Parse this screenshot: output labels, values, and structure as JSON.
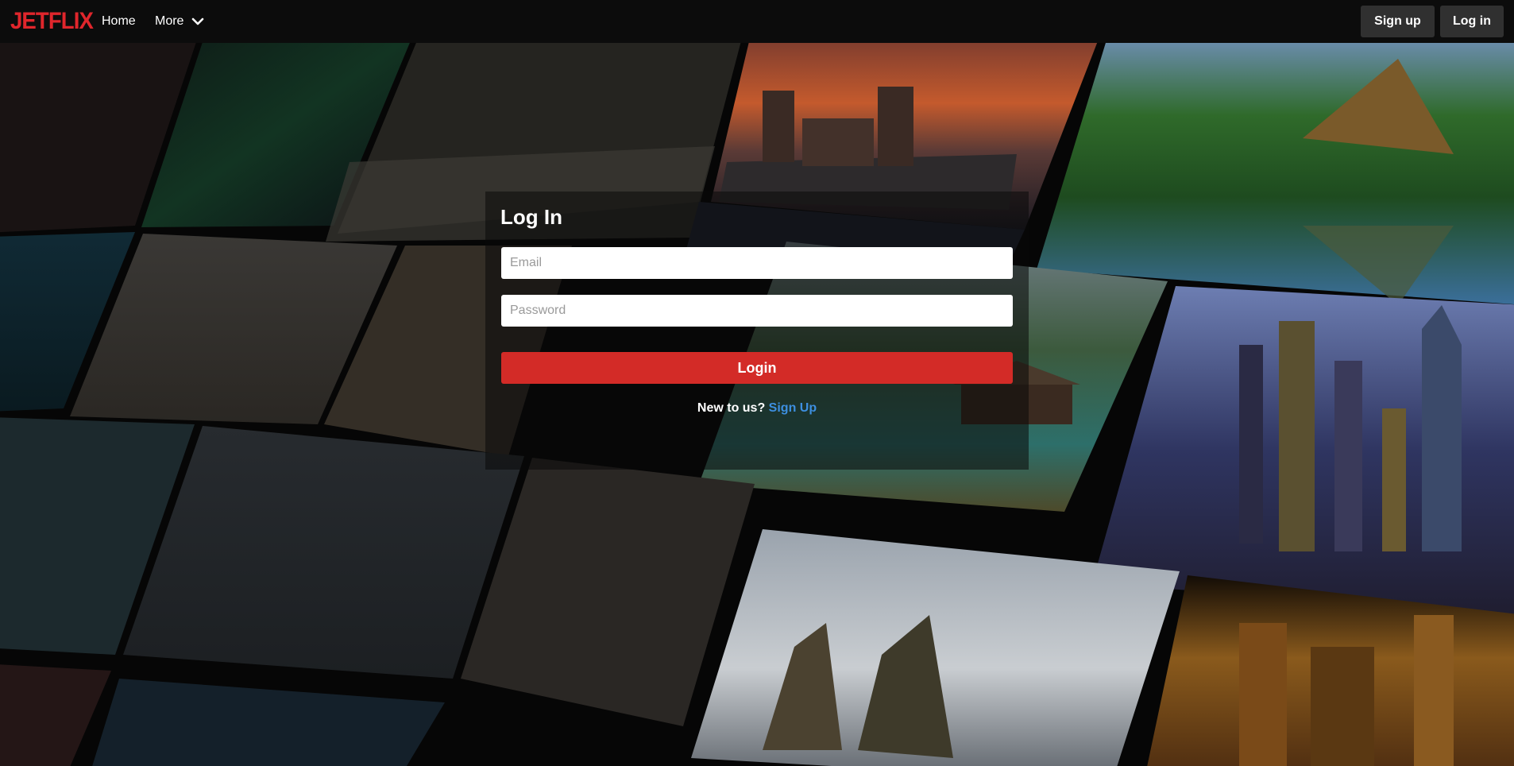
{
  "navbar": {
    "logo": "JETFLIX",
    "links": [
      "Home",
      "More"
    ],
    "signup_label": "Sign up",
    "login_label": "Log in",
    "chevron_icon": "chevron-down-icon"
  },
  "login": {
    "title": "Log In",
    "email_placeholder": "Email",
    "password_placeholder": "Password",
    "submit_label": "Login",
    "prompt": "New to us?",
    "signup_link": "Sign Up"
  },
  "colors": {
    "brand_red": "#e0262c",
    "login_button": "#d32b27",
    "link_blue": "#3d8fe0",
    "navbar_bg": "#0c0c0c",
    "nav_button_bg": "#303030"
  }
}
